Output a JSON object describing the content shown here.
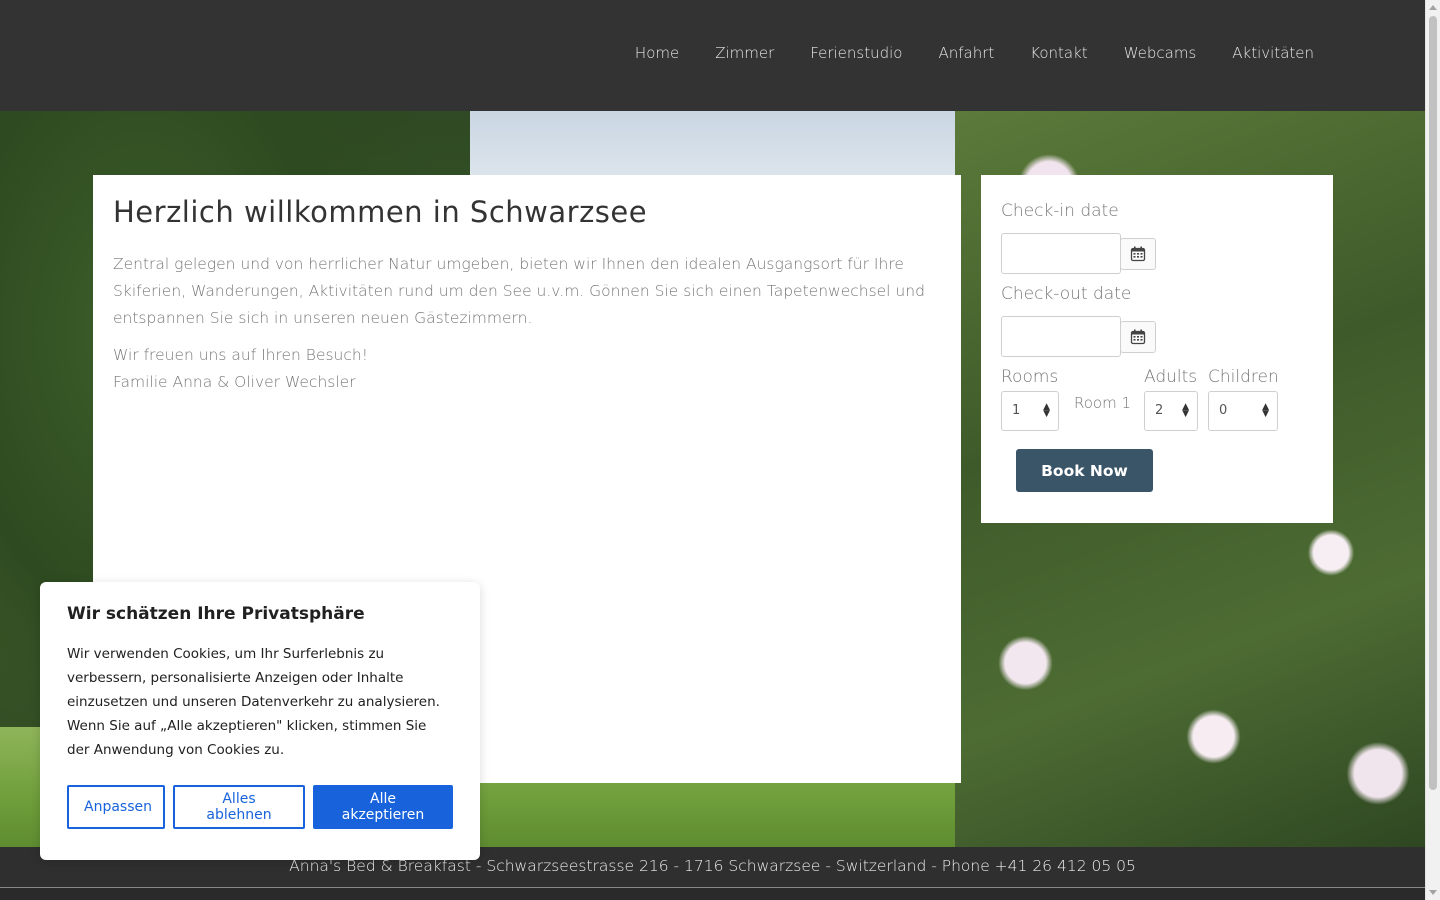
{
  "nav": {
    "items": [
      "Home",
      "Zimmer",
      "Ferienstudio",
      "Anfahrt",
      "Kontakt",
      "Webcams",
      "Aktivitäten"
    ]
  },
  "content": {
    "title": "Herzlich willkommen in Schwarzsee",
    "intro": "Zentral gelegen und von herrlicher Natur umgeben, bieten wir Ihnen den idealen Ausgangsort für Ihre Skiferien, Wanderungen, Aktivitäten rund um den See u.v.m. Gönnen Sie sich einen Tapetenwechsel und entspannen Sie sich in unseren neuen Gästezimmern.",
    "greeting": "Wir freuen uns auf Ihren Besuch!",
    "signature": "Familie Anna & Oliver Wechsler"
  },
  "booking": {
    "checkin_label": "Check-in date",
    "checkin_value": "",
    "checkout_label": "Check-out date",
    "checkout_value": "",
    "rooms_label": "Rooms",
    "rooms_value": "1",
    "room_name": "Room 1",
    "adults_label": "Adults",
    "adults_value": "2",
    "children_label": "Children",
    "children_value": "0",
    "book_label": "Book Now",
    "button_color": "#3a5468",
    "calendar_icon": "calendar-icon"
  },
  "footer": {
    "text": "Anna's Bed & Breakfast - Schwarzseestrasse 216 - 1716 Schwarzsee - Switzerland - Phone +41 26 412 05 05"
  },
  "cookie": {
    "title": "Wir schätzen Ihre Privatsphäre",
    "text": "Wir verwenden Cookies, um Ihr Surferlebnis zu verbessern, personalisierte Anzeigen oder Inhalte einzusetzen und unseren Datenverkehr zu analysieren. Wenn Sie auf „Alle akzeptieren\" klicken, stimmen Sie der Anwendung von Cookies zu.",
    "customize_label": "Anpassen",
    "reject_label": "Alles ablehnen",
    "accept_label": "Alle akzeptieren",
    "accent_color": "#1863dc"
  }
}
